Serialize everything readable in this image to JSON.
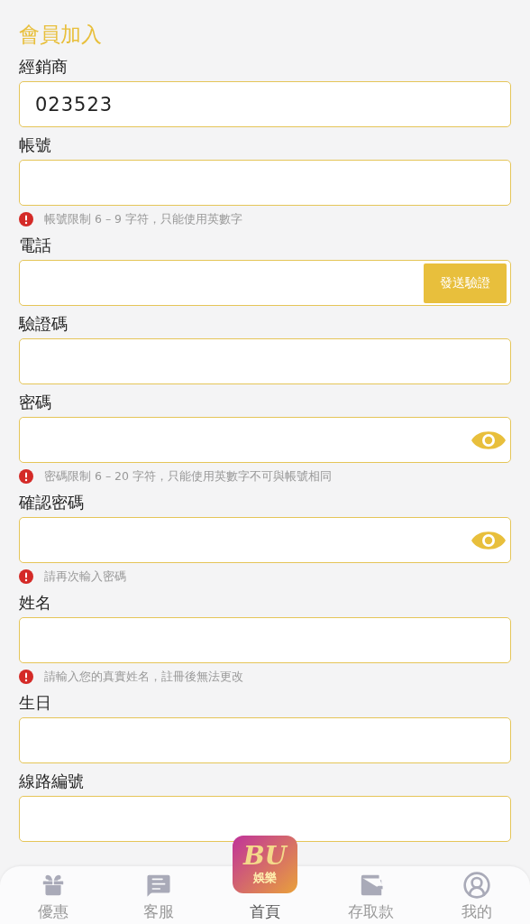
{
  "title": "會員加入",
  "fields": [
    {
      "label": "經銷商",
      "kind": "text",
      "value": "023523"
    },
    {
      "label": "帳號",
      "kind": "text",
      "hint": "帳號限制 6 – 9 字符，只能使用英數字"
    },
    {
      "label": "電話",
      "kind": "sms",
      "button": "發送驗證"
    },
    {
      "label": "驗證碼",
      "kind": "text"
    },
    {
      "label": "密碼",
      "kind": "password",
      "hint": "密碼限制 6 – 20 字符，只能使用英數字不可與帳號相同"
    },
    {
      "label": "確認密碼",
      "kind": "password",
      "hint": "請再次輸入密碼"
    },
    {
      "label": "姓名",
      "kind": "text",
      "hint": "請輸入您的真實姓名，註冊後無法更改"
    },
    {
      "label": "生日",
      "kind": "text"
    },
    {
      "label": "線路編號",
      "kind": "text"
    }
  ],
  "nav": [
    {
      "label": "優惠",
      "kind": "gift"
    },
    {
      "label": "客服",
      "kind": "chat"
    },
    {
      "label": "首頁",
      "kind": "logo",
      "logo": "BU",
      "logo_sub": "娛樂"
    },
    {
      "label": "存取款",
      "kind": "wallet"
    },
    {
      "label": "我的",
      "kind": "user"
    }
  ]
}
